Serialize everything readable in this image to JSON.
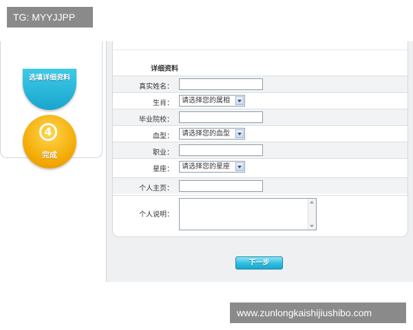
{
  "watermark": {
    "top_left": "TG: MYYJJPP",
    "bottom_right": "www.zunlongkaishijiushibo.com"
  },
  "steps": {
    "step3_label": "选填详细资料",
    "step4_number": "4",
    "step4_label": "完成"
  },
  "form": {
    "section_title": "详细资料",
    "fields": {
      "real_name": "真实姓名：",
      "zodiac": "生肖：",
      "zodiac_select": "请选择您的属相",
      "school": "毕业院校：",
      "blood_type": "血型：",
      "blood_type_select": "请选择您的血型",
      "occupation": "职业：",
      "constellation": "星座：",
      "constellation_select": "请选择您的星座",
      "homepage": "个人主页：",
      "description": "个人说明："
    },
    "next_button": "下一步"
  },
  "colors": {
    "next_button": "#2fbde0",
    "step3": "#1aa5cc",
    "step4": "#f2a600"
  }
}
